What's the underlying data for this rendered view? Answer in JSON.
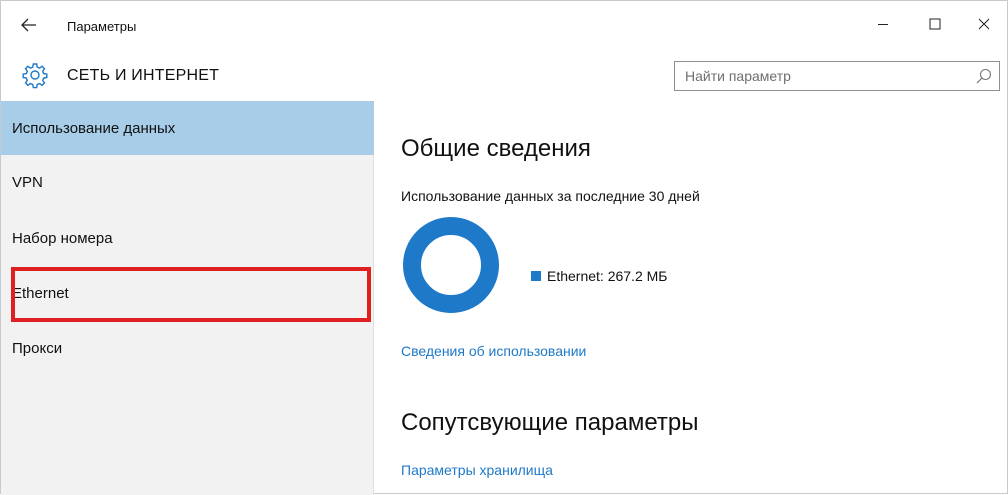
{
  "window": {
    "title": "Параметры",
    "controls": [
      "minimize-icon",
      "maximize-icon",
      "close-icon"
    ]
  },
  "header": {
    "title": "СЕТЬ И ИНТЕРНЕТ",
    "icon": "gear-icon",
    "search": {
      "placeholder": "Найти параметр",
      "value": ""
    }
  },
  "sidebar": {
    "items": [
      {
        "label": "Использование данных",
        "selected": true
      },
      {
        "label": "VPN",
        "selected": false
      },
      {
        "label": "Набор номера",
        "selected": false
      },
      {
        "label": "Ethernet",
        "selected": false,
        "highlighted": true
      },
      {
        "label": "Прокси",
        "selected": false
      }
    ]
  },
  "main": {
    "overview_title": "Общие сведения",
    "usage_subtitle": "Использование данных за последние 30 дней",
    "chart": {
      "type": "donut",
      "segments": [
        {
          "label": "Ethernet: 267.2 МБ",
          "name": "Ethernet",
          "value_mb": 267.2,
          "color": "#1e79c8"
        }
      ]
    },
    "usage_details_link": "Сведения об использовании",
    "related_title": "Сопутсвующие параметры",
    "storage_link": "Параметры хранилища"
  },
  "colors": {
    "accent": "#1e79c8",
    "selected_bg": "#a7cde9",
    "sidebar_bg": "#f2f2f2",
    "highlight_border": "#e02020"
  }
}
